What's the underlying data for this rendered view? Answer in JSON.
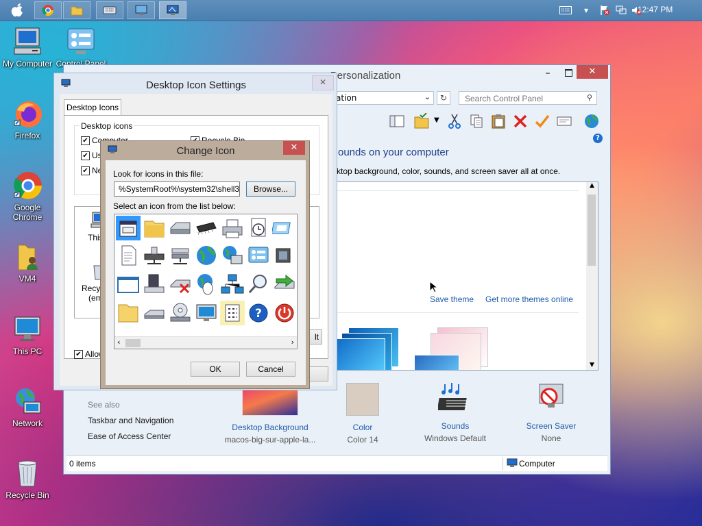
{
  "taskbar": {
    "clock": "12:47 PM"
  },
  "desktop_icons": [
    {
      "label": "My Computer"
    },
    {
      "label": "Control Panel"
    },
    {
      "label": "Firefox"
    },
    {
      "label": "Google Chrome"
    },
    {
      "label": "VM4"
    },
    {
      "label": "This PC"
    },
    {
      "label": "Network"
    },
    {
      "label": "Recycle Bin"
    }
  ],
  "personalization": {
    "title": "Personalization",
    "address_text": "ation",
    "search_placeholder": "Search Control Panel",
    "heading": "ounds on your computer",
    "subheading": "ktop background, color, sounds, and screen saver all at once.",
    "save_theme": "Save theme",
    "more_themes": "Get more themes online",
    "see_also": "See also",
    "links": [
      "Taskbar and Navigation",
      "Ease of Access Center"
    ],
    "bottom_items": [
      {
        "title": "Desktop Background",
        "sub": "macos-big-sur-apple-la..."
      },
      {
        "title": "Color",
        "sub": "Color 14"
      },
      {
        "title": "Sounds",
        "sub": "Windows Default"
      },
      {
        "title": "Screen Saver",
        "sub": "None"
      }
    ],
    "status_items": "0 items",
    "status_location": "Computer"
  },
  "desktop_icon_settings": {
    "title": "Desktop Icon Settings",
    "tab": "Desktop Icons",
    "group_label": "Desktop icons",
    "checks": [
      {
        "label": "Computer",
        "checked": true
      },
      {
        "label": "Use",
        "checked": true
      },
      {
        "label": "Net",
        "checked": true
      },
      {
        "label": "Recycle Bin",
        "checked": true
      }
    ],
    "preview_labels": [
      "This",
      "Recyc",
      "(emp"
    ],
    "allow_label": "Allow",
    "restore_btn_fragment": "lt"
  },
  "change_icon": {
    "title": "Change Icon",
    "file_label": "Look for icons in this file:",
    "file_value": "%SystemRoot%\\system32\\shell32.dll",
    "browse": "Browse...",
    "list_label": "Select an icon from the list below:",
    "ok": "OK",
    "cancel": "Cancel"
  },
  "colors": {
    "accent_blue": "#1e5aa8",
    "close_red": "#c75050",
    "selection": "#3399ff"
  }
}
